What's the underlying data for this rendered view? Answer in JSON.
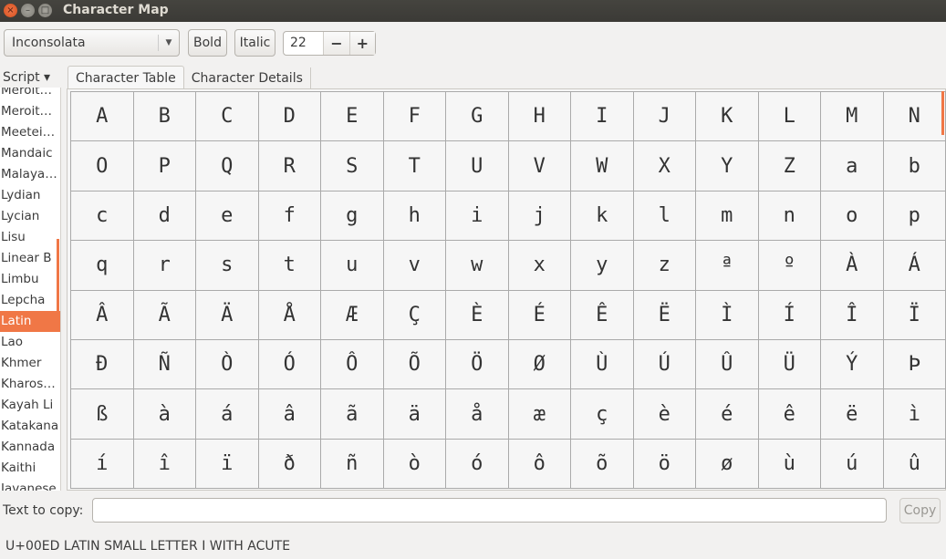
{
  "window": {
    "title": "Character Map"
  },
  "toolbar": {
    "font": "Inconsolata",
    "bold": "Bold",
    "italic": "Italic",
    "size": "22",
    "minus": "−",
    "plus": "+"
  },
  "sidebar": {
    "header": "Script ▾",
    "items": [
      "Meroit…",
      "Meroit…",
      "Meetei…",
      "Mandaic",
      "Malaya…",
      "Lydian",
      "Lycian",
      "Lisu",
      "Linear B",
      "Limbu",
      "Lepcha",
      "Latin",
      "Lao",
      "Khmer",
      "Kharos…",
      "Kayah Li",
      "Katakana",
      "Kannada",
      "Kaithi",
      "Javanese"
    ],
    "selected": "Latin"
  },
  "tabs": [
    {
      "label": "Character Table",
      "active": true
    },
    {
      "label": "Character Details",
      "active": false
    }
  ],
  "grid": {
    "rows": [
      [
        "A",
        "B",
        "C",
        "D",
        "E",
        "F",
        "G",
        "H",
        "I",
        "J",
        "K",
        "L",
        "M",
        "N"
      ],
      [
        "O",
        "P",
        "Q",
        "R",
        "S",
        "T",
        "U",
        "V",
        "W",
        "X",
        "Y",
        "Z",
        "a",
        "b"
      ],
      [
        "c",
        "d",
        "e",
        "f",
        "g",
        "h",
        "i",
        "j",
        "k",
        "l",
        "m",
        "n",
        "o",
        "p"
      ],
      [
        "q",
        "r",
        "s",
        "t",
        "u",
        "v",
        "w",
        "x",
        "y",
        "z",
        "ª",
        "º",
        "À",
        "Á"
      ],
      [
        "Â",
        "Ã",
        "Ä",
        "Å",
        "Æ",
        "Ç",
        "È",
        "É",
        "Ê",
        "Ë",
        "Ì",
        "Í",
        "Î",
        "Ï"
      ],
      [
        "Ð",
        "Ñ",
        "Ò",
        "Ó",
        "Ô",
        "Õ",
        "Ö",
        "Ø",
        "Ù",
        "Ú",
        "Û",
        "Ü",
        "Ý",
        "Þ"
      ],
      [
        "ß",
        "à",
        "á",
        "â",
        "ã",
        "ä",
        "å",
        "æ",
        "ç",
        "è",
        "é",
        "ê",
        "ë",
        "ì"
      ],
      [
        "í",
        "î",
        "ï",
        "ð",
        "ñ",
        "ò",
        "ó",
        "ô",
        "õ",
        "ö",
        "ø",
        "ù",
        "ú",
        "û"
      ]
    ]
  },
  "copy": {
    "label": "Text to copy:",
    "value": "",
    "button": "Copy"
  },
  "status": "U+00ED LATIN SMALL LETTER I WITH ACUTE",
  "colors": {
    "accent": "#f07746"
  }
}
